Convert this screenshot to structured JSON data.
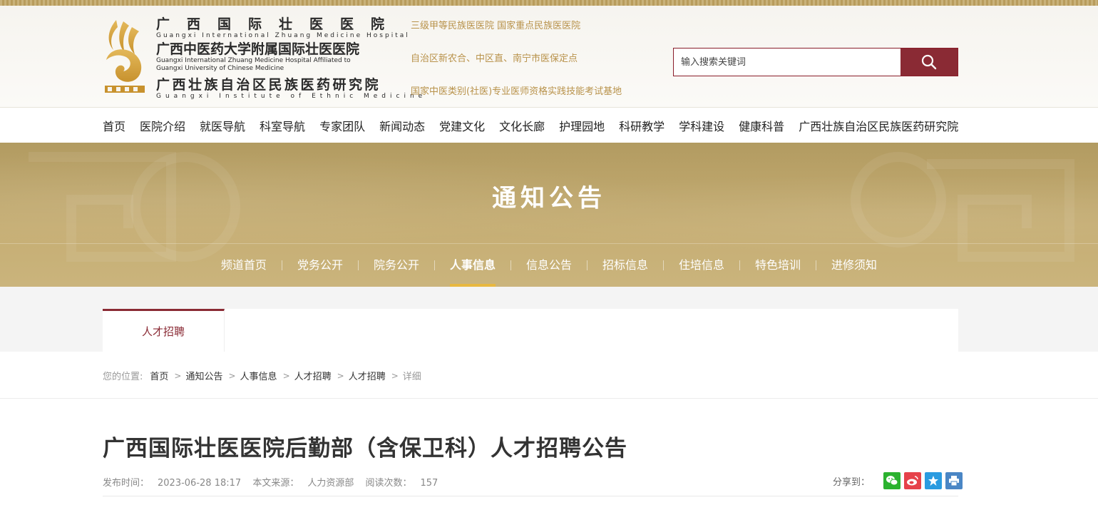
{
  "header": {
    "name_zh_1": "广西国际壮医医院",
    "name_en_1": "Guangxi International Zhuang Medicine Hospital",
    "name_zh_2": "广西中医药大学附属国际壮医医院",
    "name_en_2a": "Guangxi International Zhuang Medicine Hospital Affiliated to",
    "name_en_2b": "Guangxi University of Chinese Medicine",
    "name_zh_3": "广西壮族自治区民族医药研究院",
    "name_en_3": "Guangxi Institute of Ethnic Medicine",
    "taglines": [
      "三级甲等民族医医院   国家重点民族医医院",
      "自治区新农合、中区直、南宁市医保定点",
      "国家中医类别(社医)专业医师资格实践技能考试基地"
    ]
  },
  "search": {
    "placeholder": "输入搜索关键词"
  },
  "nav": {
    "items": [
      "首页",
      "医院介绍",
      "就医导航",
      "科室导航",
      "专家团队",
      "新闻动态",
      "党建文化",
      "文化长廊",
      "护理园地",
      "科研教学",
      "学科建设",
      "健康科普",
      "广西壮族自治区民族医药研究院"
    ]
  },
  "banner": {
    "title": "通知公告"
  },
  "subnav": {
    "items": [
      "频道首页",
      "党务公开",
      "院务公开",
      "人事信息",
      "信息公告",
      "招标信息",
      "住培信息",
      "特色培训",
      "进修须知"
    ],
    "active_index": 3
  },
  "tabs": {
    "active_label": "人才招聘"
  },
  "breadcrumb": {
    "prefix": "您的位置:",
    "items": [
      "首页",
      "通知公告",
      "人事信息",
      "人才招聘",
      "人才招聘",
      "详细"
    ]
  },
  "article": {
    "title": "广西国际壮医医院后勤部（含保卫科）人才招聘公告",
    "publish_label": "发布时间：",
    "publish_time": "2023-06-28 18:17",
    "source_label": "本文来源：",
    "source": "人力资源部",
    "reads_label": "阅读次数：",
    "reads": "157"
  },
  "share": {
    "label": "分享到：",
    "colors": {
      "wechat": "#2bb22f",
      "weibo": "#e6424a",
      "qzone": "#2a9be0",
      "print": "#4a86c5"
    }
  }
}
